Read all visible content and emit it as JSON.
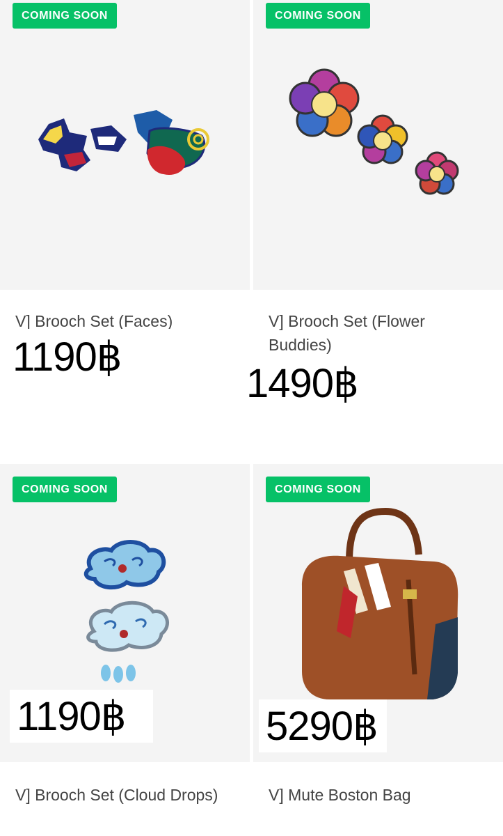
{
  "products": [
    {
      "badge": "COMING SOON",
      "name": "V] Brooch Set (Faces)",
      "price": "1190฿",
      "image": "faces-brooch-set"
    },
    {
      "badge": "COMING SOON",
      "name": "V] Brooch Set (Flower Buddies)",
      "price": "1490฿",
      "image": "flower-brooch-set"
    },
    {
      "badge": "COMING SOON",
      "name": "V] Brooch Set (Cloud Drops)",
      "price": "1190฿",
      "image": "cloud-brooch-set"
    },
    {
      "badge": "COMING SOON",
      "name": "V] Mute Boston Bag",
      "price": "5290฿",
      "image": "boston-bag"
    }
  ],
  "colors": {
    "badge_bg": "#06c167",
    "image_bg": "#f4f4f4",
    "name_text": "#444444"
  }
}
